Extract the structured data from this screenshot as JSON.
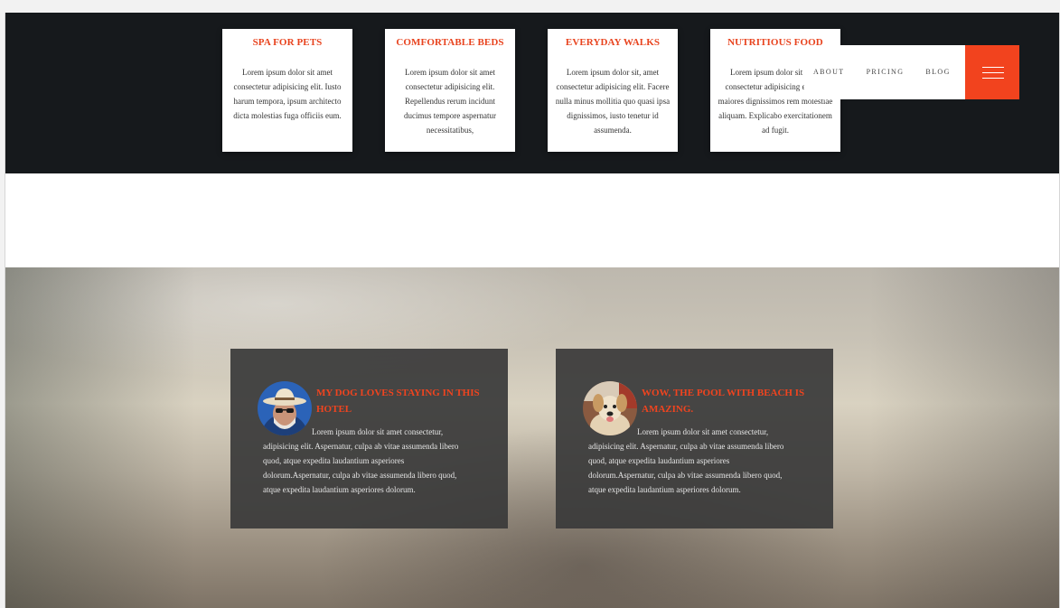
{
  "features": [
    {
      "title": "SPA FOR PETS",
      "text": "Lorem ipsum dolor sit amet consectetur adipisicing elit. Iusto harum tempora, ipsum architecto dicta molestias fuga officiis eum."
    },
    {
      "title": "COMFORTABLE BEDS",
      "text": "Lorem ipsum dolor sit amet consectetur adipisicing elit. Repellendus rerum incidunt ducimus tempore aspernatur necessitatibus,"
    },
    {
      "title": "EVERYDAY WALKS",
      "text": "Lorem ipsum dolor sit, amet consectetur adipisicing elit. Facere nulla minus mollitia quo quasi ipsa dignissimos, iusto tenetur id assumenda."
    },
    {
      "title": "NUTRITIOUS FOOD",
      "text": "Lorem ipsum dolor sit amet consectetur adipisicing elit. Ex maiores dignissimos rem molestiae aliquam. Explicabo exercitationem ad fugit."
    }
  ],
  "nav": {
    "about": "ABOUT",
    "pricing": "PRICING",
    "blog": "BLOG",
    "menu_icon": "hamburger-icon"
  },
  "testimonials": [
    {
      "title": "MY DOG LOVES STAYING IN THIS HOTEL",
      "text": "Lorem ipsum dolor sit amet consectetur, adipisicing elit. Aspernatur, culpa ab vitae assumenda libero quod, atque expedita laudantium asperiores dolorum.Aspernatur, culpa ab vitae assumenda libero quod, atque expedita laudantium asperiores dolorum.",
      "avatar": "man-with-hat-avatar"
    },
    {
      "title": "WOW, THE POOL WITH BEACH IS AMAZING.",
      "text": "Lorem ipsum dolor sit amet consectetur, adipisicing elit. Aspernatur, culpa ab vitae assumenda libero quod, atque expedita laudantium asperiores dolorum.Aspernatur, culpa ab vitae assumenda libero quod, atque expedita laudantium asperiores dolorum.",
      "avatar": "dog-avatar"
    }
  ],
  "colors": {
    "accent": "#f2431e",
    "dark_band": "#16191c",
    "card_dark": "#3a3a3a"
  }
}
